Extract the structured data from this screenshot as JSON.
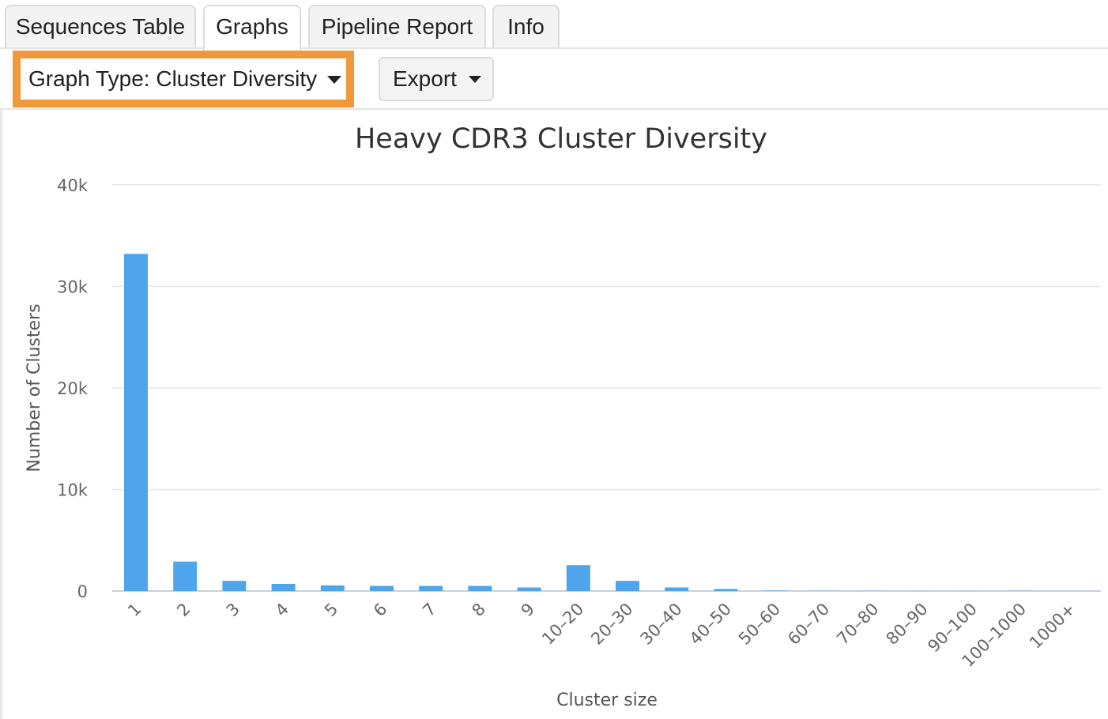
{
  "tabs": [
    {
      "label": "Sequences Table",
      "active": false
    },
    {
      "label": "Graphs",
      "active": true
    },
    {
      "label": "Pipeline Report",
      "active": false
    },
    {
      "label": "Info",
      "active": false
    }
  ],
  "toolbar": {
    "graph_type_label": "Graph Type: Cluster Diversity",
    "export_label": "Export",
    "highlight_color": "#f0993a"
  },
  "chart_data": {
    "type": "bar",
    "title": "Heavy CDR3 Cluster Diversity",
    "xlabel": "Cluster size",
    "ylabel": "Number of Clusters",
    "ylim": [
      0,
      40000
    ],
    "yticks": [
      0,
      10000,
      20000,
      30000,
      40000
    ],
    "ytick_labels": [
      "0",
      "10k",
      "20k",
      "30k",
      "40k"
    ],
    "grid": true,
    "bar_color": "#4ea5ec",
    "categories": [
      "1",
      "2",
      "3",
      "4",
      "5",
      "6",
      "7",
      "8",
      "9",
      "10–20",
      "20–30",
      "30–40",
      "40–50",
      "50–60",
      "60–70",
      "70–80",
      "80–90",
      "90–100",
      "100–1000",
      "1000+"
    ],
    "values": [
      33200,
      2900,
      1000,
      700,
      550,
      500,
      500,
      500,
      350,
      2550,
      1000,
      350,
      200,
      40,
      20,
      10,
      5,
      5,
      10,
      0
    ]
  }
}
